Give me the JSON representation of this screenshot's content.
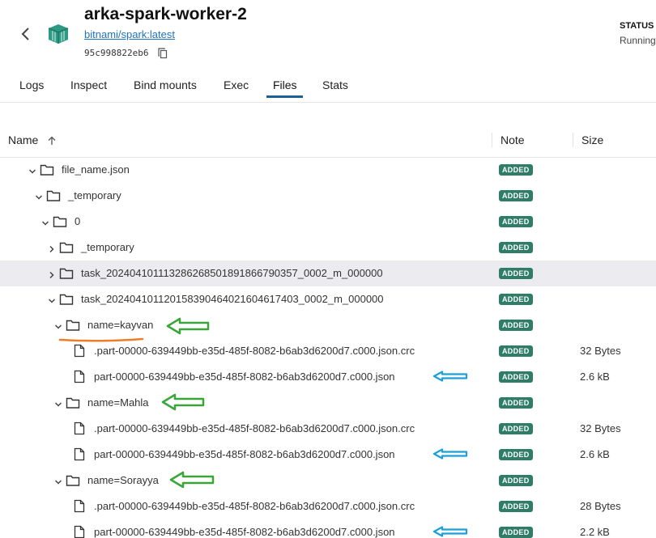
{
  "container": {
    "name": "arka-spark-worker-2",
    "image": "bitnami/spark:latest",
    "id": "95c998822eb6",
    "status_label": "STATUS",
    "status_value": "Running"
  },
  "tabs": [
    {
      "label": "Logs"
    },
    {
      "label": "Inspect"
    },
    {
      "label": "Bind mounts"
    },
    {
      "label": "Exec"
    },
    {
      "label": "Files",
      "active": true
    },
    {
      "label": "Stats"
    }
  ],
  "columns": {
    "name": "Name",
    "note": "Note",
    "size": "Size"
  },
  "rows": [
    {
      "type": "folder",
      "label": "file_name.json",
      "expanded": true,
      "badge": "ADDED",
      "size": ""
    },
    {
      "type": "folder",
      "label": "_temporary",
      "expanded": true,
      "badge": "ADDED",
      "size": ""
    },
    {
      "type": "folder",
      "label": "0",
      "expanded": true,
      "badge": "ADDED",
      "size": ""
    },
    {
      "type": "folder",
      "label": "_temporary",
      "expanded": false,
      "badge": "ADDED",
      "size": ""
    },
    {
      "type": "folder",
      "label": "task_202404101113286268501891866790357_0002_m_000000",
      "expanded": false,
      "badge": "ADDED",
      "size": "",
      "highlighted": true
    },
    {
      "type": "folder",
      "label": "task_202404101120158390464021604617403_0002_m_000000",
      "expanded": true,
      "badge": "ADDED",
      "size": ""
    },
    {
      "type": "folder",
      "label": "name=kayvan",
      "expanded": true,
      "badge": "ADDED",
      "size": ""
    },
    {
      "type": "file",
      "label": ".part-00000-639449bb-e35d-485f-8082-b6ab3d6200d7.c000.json.crc",
      "badge": "ADDED",
      "size": "32 Bytes"
    },
    {
      "type": "file",
      "label": "part-00000-639449bb-e35d-485f-8082-b6ab3d6200d7.c000.json",
      "badge": "ADDED",
      "size": "2.6 kB"
    },
    {
      "type": "folder",
      "label": "name=Mahla",
      "expanded": true,
      "badge": "ADDED",
      "size": ""
    },
    {
      "type": "file",
      "label": ".part-00000-639449bb-e35d-485f-8082-b6ab3d6200d7.c000.json.crc",
      "badge": "ADDED",
      "size": "32 Bytes"
    },
    {
      "type": "file",
      "label": "part-00000-639449bb-e35d-485f-8082-b6ab3d6200d7.c000.json",
      "badge": "ADDED",
      "size": "2.6 kB"
    },
    {
      "type": "folder",
      "label": "name=Sorayya",
      "expanded": true,
      "badge": "ADDED",
      "size": ""
    },
    {
      "type": "file",
      "label": ".part-00000-639449bb-e35d-485f-8082-b6ab3d6200d7.c000.json.crc",
      "badge": "ADDED",
      "size": "28 Bytes"
    },
    {
      "type": "file",
      "label": "part-00000-639449bb-e35d-485f-8082-b6ab3d6200d7.c000.json",
      "badge": "ADDED",
      "size": "2.2 kB"
    }
  ],
  "colors": {
    "accent": "#1c5f93",
    "badge": "#2e7d67",
    "link": "#1c73c4",
    "annotation_orange": "#f07c27",
    "annotation_green": "#3aa63a",
    "annotation_blue": "#1aa0d8"
  },
  "icons": [
    "back-chevron-icon",
    "container-icon",
    "copy-icon",
    "sort-arrow-up-icon",
    "folder-icon",
    "file-icon",
    "chevron-down-icon",
    "chevron-right-icon"
  ]
}
